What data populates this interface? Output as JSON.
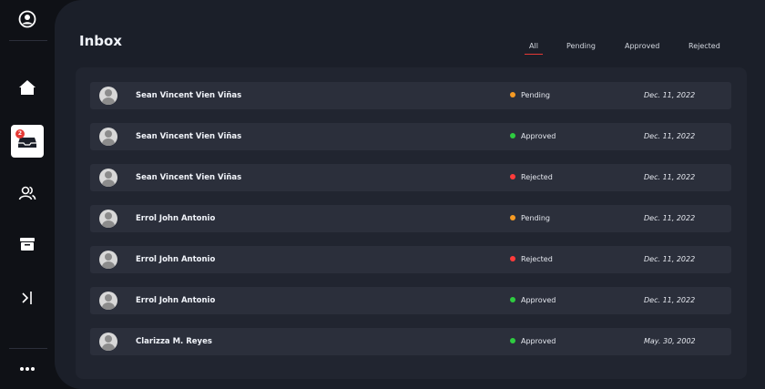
{
  "sidebar": {
    "items": [
      {
        "icon": "user-circle-icon"
      },
      {
        "icon": "home-icon"
      },
      {
        "icon": "inbox-icon",
        "badge": "2"
      },
      {
        "icon": "users-icon"
      },
      {
        "icon": "archive-icon"
      },
      {
        "icon": "expand-sidebar-icon"
      },
      {
        "icon": "more-icon"
      }
    ]
  },
  "header": {
    "title": "Inbox",
    "tabs": [
      "All",
      "Pending",
      "Approved",
      "Rejected"
    ],
    "active_tab": "All"
  },
  "colors": {
    "Pending": "#f59a23",
    "Approved": "#2ecc40",
    "Rejected": "#ff3b3b",
    "accent": "#e53935"
  },
  "rows": [
    {
      "name": "Sean Vincent Vien Viñas",
      "status": "Pending",
      "date": "Dec. 11, 2022"
    },
    {
      "name": "Sean Vincent Vien Viñas",
      "status": "Approved",
      "date": "Dec. 11, 2022"
    },
    {
      "name": "Sean Vincent Vien Viñas",
      "status": "Rejected",
      "date": "Dec. 11, 2022"
    },
    {
      "name": "Errol John Antonio",
      "status": "Pending",
      "date": "Dec. 11, 2022"
    },
    {
      "name": "Errol John Antonio",
      "status": "Rejected",
      "date": "Dec. 11, 2022"
    },
    {
      "name": "Errol John Antonio",
      "status": "Approved",
      "date": "Dec. 11, 2022"
    },
    {
      "name": "Clarizza M. Reyes",
      "status": "Approved",
      "date": "May. 30, 2002"
    }
  ]
}
